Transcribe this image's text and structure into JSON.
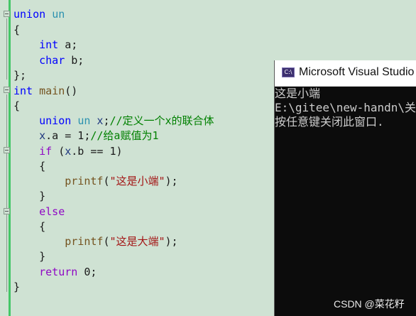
{
  "editor": {
    "lines": [
      [
        {
          "t": "union",
          "c": "kw"
        },
        {
          "t": " ",
          "c": ""
        },
        {
          "t": "un",
          "c": "type"
        }
      ],
      [
        {
          "t": "{",
          "c": ""
        }
      ],
      [
        {
          "t": "    ",
          "c": ""
        },
        {
          "t": "int",
          "c": "kw"
        },
        {
          "t": " a;",
          "c": ""
        }
      ],
      [
        {
          "t": "    ",
          "c": ""
        },
        {
          "t": "char",
          "c": "kw"
        },
        {
          "t": " b;",
          "c": ""
        }
      ],
      [
        {
          "t": "};",
          "c": ""
        }
      ],
      [
        {
          "t": "int",
          "c": "kw"
        },
        {
          "t": " ",
          "c": ""
        },
        {
          "t": "main",
          "c": "fn"
        },
        {
          "t": "()",
          "c": ""
        }
      ],
      [
        {
          "t": "{",
          "c": ""
        }
      ],
      [
        {
          "t": "    ",
          "c": ""
        },
        {
          "t": "union",
          "c": "kw"
        },
        {
          "t": " ",
          "c": ""
        },
        {
          "t": "un",
          "c": "type"
        },
        {
          "t": " ",
          "c": ""
        },
        {
          "t": "x",
          "c": "var"
        },
        {
          "t": ";",
          "c": ""
        },
        {
          "t": "//定义一个x的联合体",
          "c": "cmt"
        }
      ],
      [
        {
          "t": "    ",
          "c": ""
        },
        {
          "t": "x",
          "c": "var"
        },
        {
          "t": ".a = 1;",
          "c": ""
        },
        {
          "t": "//给a赋值为1",
          "c": "cmt"
        }
      ],
      [
        {
          "t": "    ",
          "c": ""
        },
        {
          "t": "if",
          "c": "kw-purple"
        },
        {
          "t": " (",
          "c": ""
        },
        {
          "t": "x",
          "c": "var"
        },
        {
          "t": ".b == 1)",
          "c": ""
        }
      ],
      [
        {
          "t": "    {",
          "c": ""
        }
      ],
      [
        {
          "t": "        ",
          "c": ""
        },
        {
          "t": "printf",
          "c": "fn"
        },
        {
          "t": "(",
          "c": ""
        },
        {
          "t": "\"这是小端\"",
          "c": "str"
        },
        {
          "t": ");",
          "c": ""
        }
      ],
      [
        {
          "t": "    }",
          "c": ""
        }
      ],
      [
        {
          "t": "    ",
          "c": ""
        },
        {
          "t": "else",
          "c": "kw-purple"
        }
      ],
      [
        {
          "t": "    {",
          "c": ""
        }
      ],
      [
        {
          "t": "        ",
          "c": ""
        },
        {
          "t": "printf",
          "c": "fn"
        },
        {
          "t": "(",
          "c": ""
        },
        {
          "t": "\"这是大端\"",
          "c": "str"
        },
        {
          "t": ");",
          "c": ""
        }
      ],
      [
        {
          "t": "    }",
          "c": ""
        }
      ],
      [
        {
          "t": "    ",
          "c": ""
        },
        {
          "t": "return",
          "c": "kw-purple"
        },
        {
          "t": " 0;",
          "c": ""
        }
      ],
      [
        {
          "t": "}",
          "c": ""
        }
      ]
    ]
  },
  "console": {
    "icon_label": "C:\\",
    "title": "Microsoft Visual Studio",
    "output": [
      "这是小端",
      "E:\\gitee\\new-handn\\关",
      "按任意键关闭此窗口."
    ]
  },
  "watermark": "CSDN @菜花籽"
}
